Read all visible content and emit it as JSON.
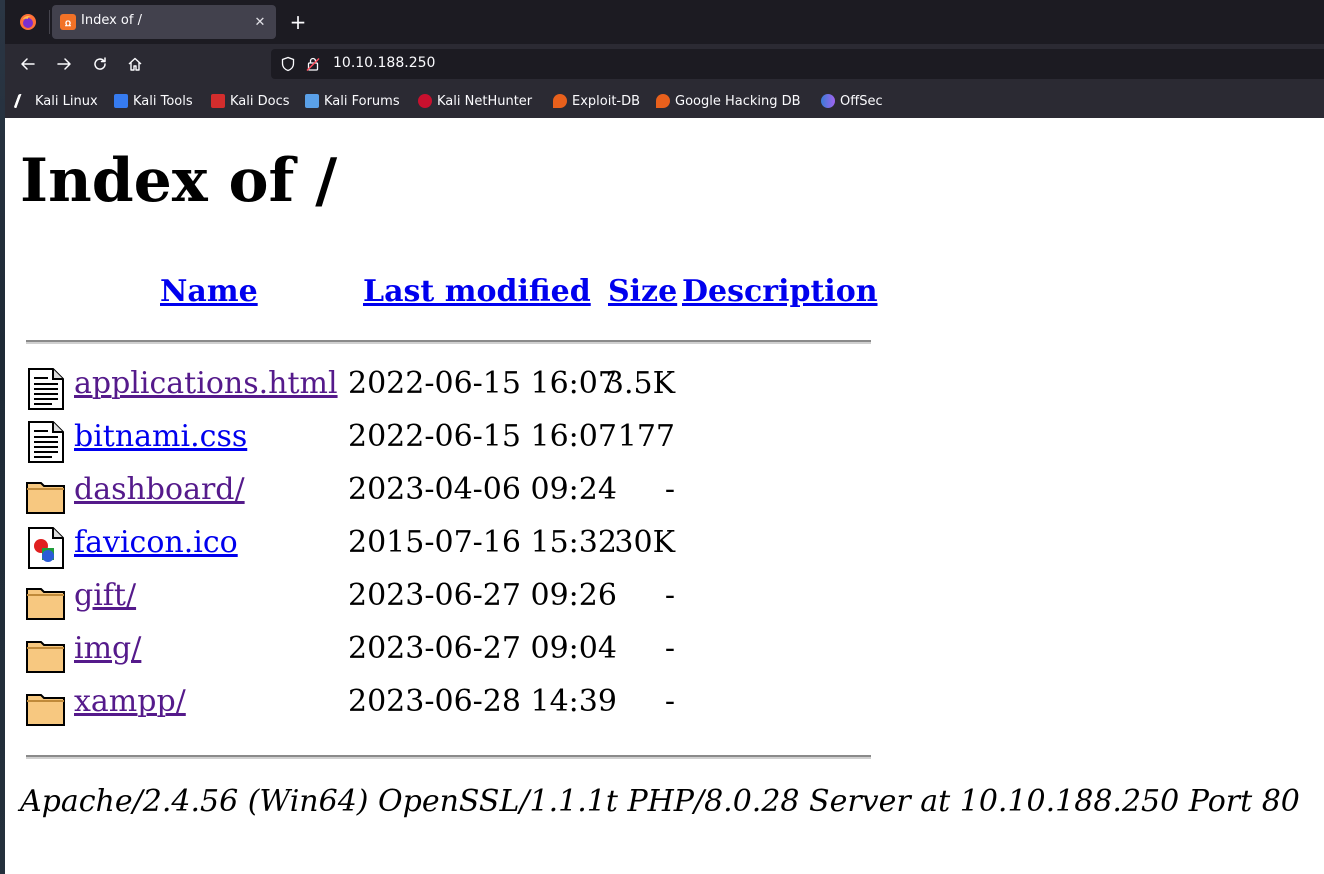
{
  "browser": {
    "tab": {
      "title": "Index of /",
      "favicon": "xampp-icon"
    },
    "new_tab_label": "+",
    "close_tab_label": "✕",
    "url": "10.10.188.250",
    "bookmarks": [
      {
        "label": "Kali Linux",
        "icon": "kali-dragon-icon"
      },
      {
        "label": "Kali Tools",
        "icon": "kali-tools-icon"
      },
      {
        "label": "Kali Docs",
        "icon": "kali-docs-icon"
      },
      {
        "label": "Kali Forums",
        "icon": "kali-forums-icon"
      },
      {
        "label": "Kali NetHunter",
        "icon": "kali-nethunter-icon"
      },
      {
        "label": "Exploit-DB",
        "icon": "exploit-db-icon"
      },
      {
        "label": "Google Hacking DB",
        "icon": "ghdb-icon"
      },
      {
        "label": "OffSec",
        "icon": "offsec-icon"
      }
    ]
  },
  "page": {
    "heading": "Index of /",
    "columns": {
      "name": "Name",
      "last_modified": "Last modified",
      "size": "Size",
      "description": "Description"
    },
    "files": [
      {
        "name": "applications.html",
        "modified": "2022-06-15 16:07",
        "size": "3.5K",
        "type": "text",
        "visited": true
      },
      {
        "name": "bitnami.css",
        "modified": "2022-06-15 16:07",
        "size": "177",
        "type": "text",
        "visited": false
      },
      {
        "name": "dashboard/",
        "modified": "2023-04-06 09:24",
        "size": "-",
        "type": "folder",
        "visited": true
      },
      {
        "name": "favicon.ico",
        "modified": "2015-07-16 15:32",
        "size": "30K",
        "type": "image",
        "visited": false
      },
      {
        "name": "gift/",
        "modified": "2023-06-27 09:26",
        "size": "-",
        "type": "folder",
        "visited": true
      },
      {
        "name": "img/",
        "modified": "2023-06-27 09:04",
        "size": "-",
        "type": "folder",
        "visited": true
      },
      {
        "name": "xampp/",
        "modified": "2023-06-28 14:39",
        "size": "-",
        "type": "folder",
        "visited": true
      }
    ],
    "address": "Apache/2.4.56 (Win64) OpenSSL/1.1.1t PHP/8.0.28 Server at 10.10.188.250 Port 80"
  },
  "colors": {
    "link": "#0000ee",
    "visited_link": "#551a8b",
    "chrome_bg": "#2b2a33",
    "tabbar_bg": "#1c1b22"
  }
}
